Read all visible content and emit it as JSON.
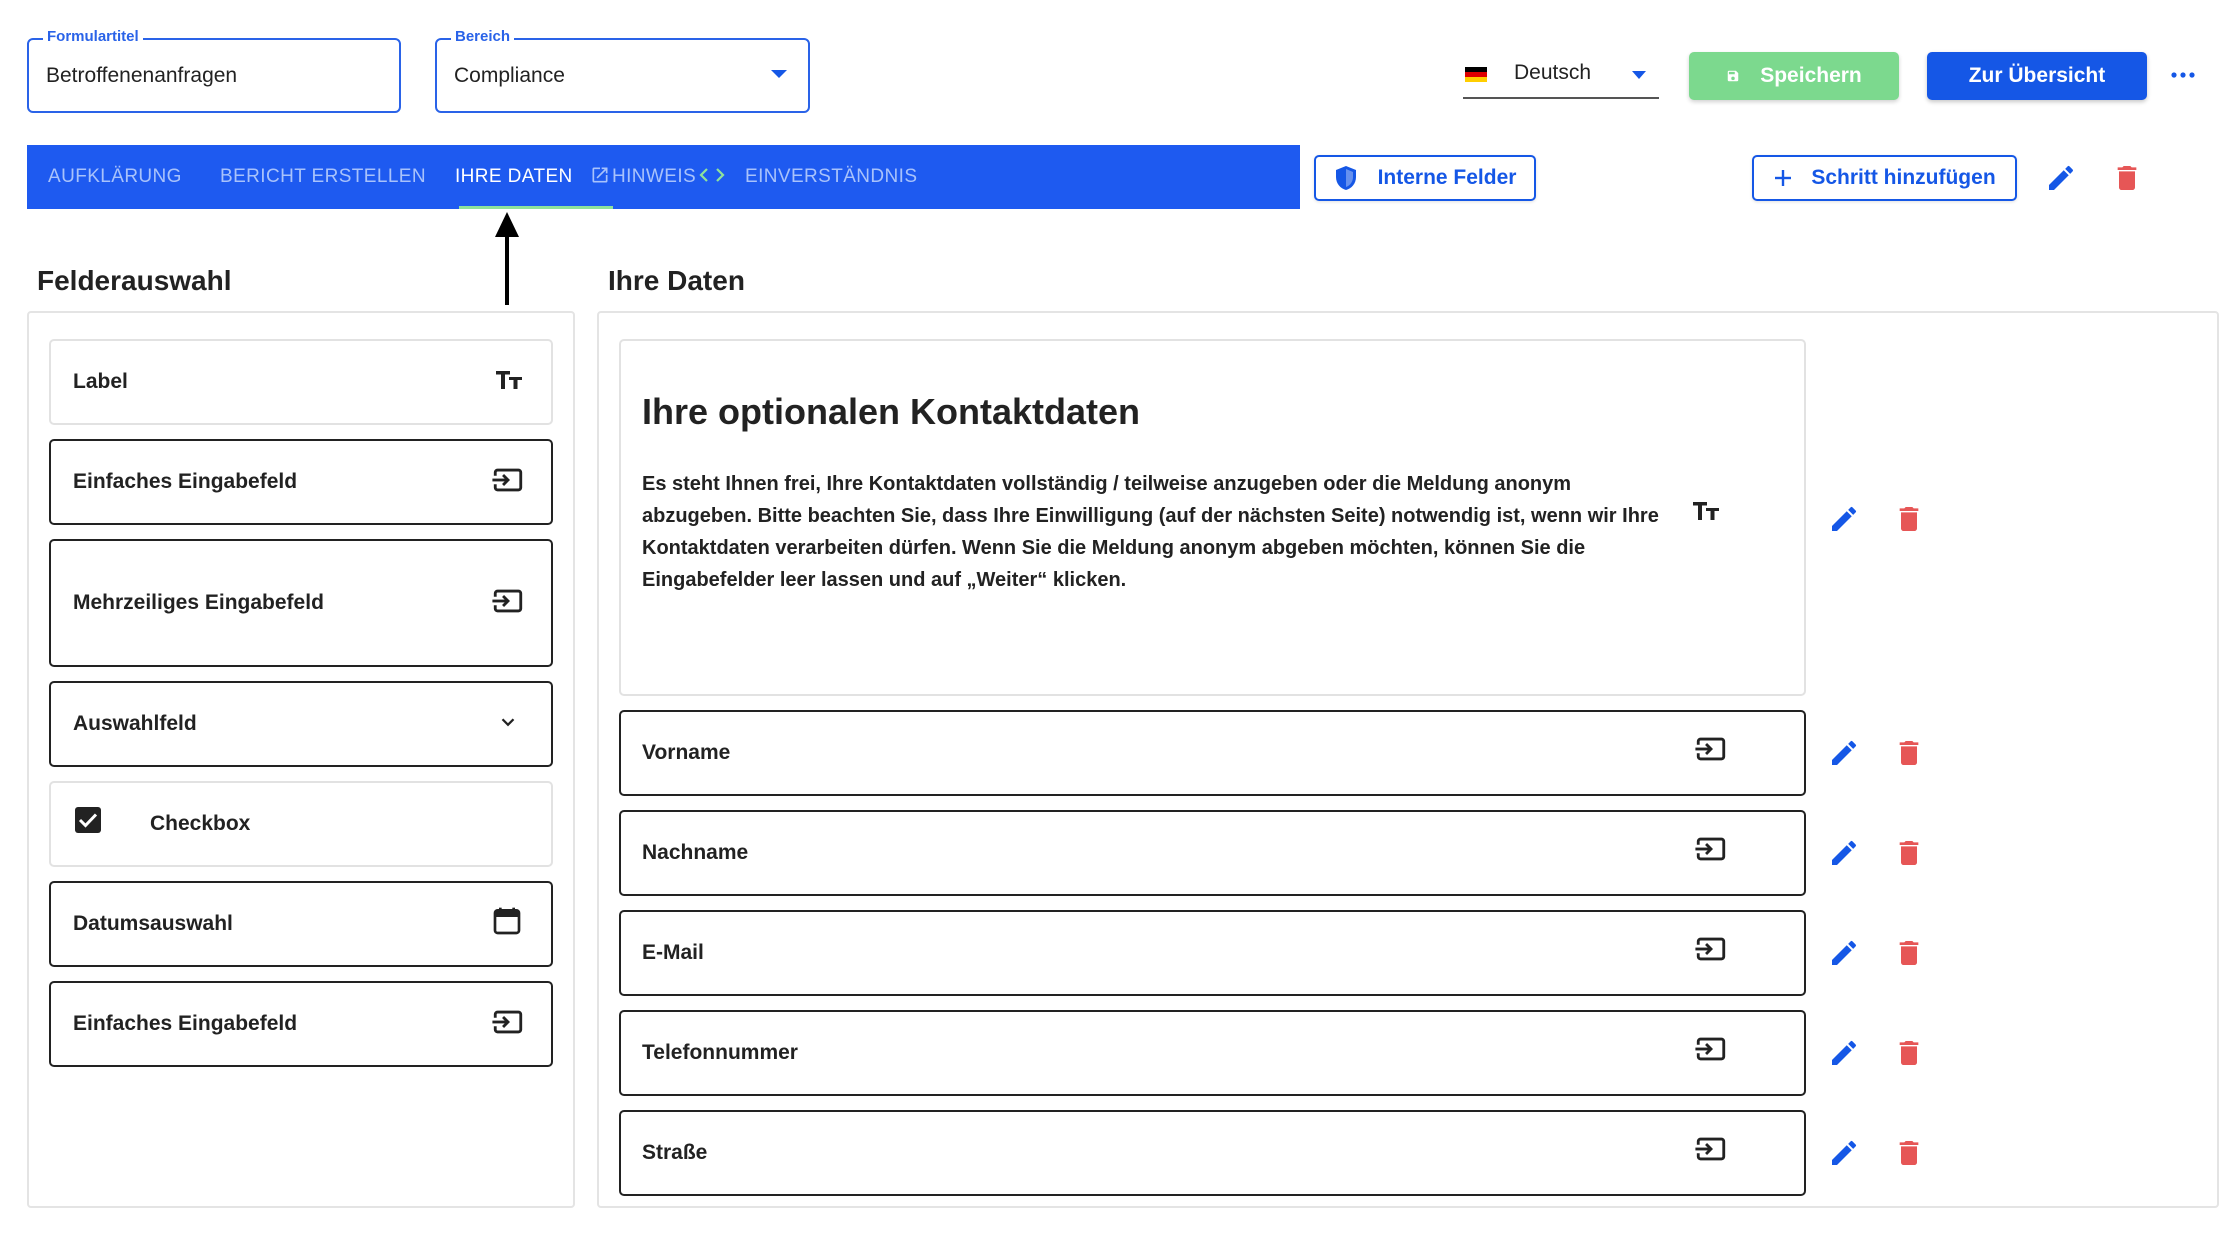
{
  "header": {
    "form_title": {
      "label": "Formulartitel",
      "value": "Betroffenenanfragen"
    },
    "area": {
      "label": "Bereich",
      "value": "Compliance"
    },
    "language": {
      "value": "Deutsch",
      "flag": "de-flag-icon"
    },
    "save_label": "Speichern",
    "overview_label": "Zur Übersicht",
    "more_icon": "more-horizontal-icon"
  },
  "tabs": [
    {
      "label": "AUFKLÄRUNG",
      "active": false
    },
    {
      "label": "BERICHT ERSTELLEN",
      "active": false
    },
    {
      "label": "IHRE DATEN",
      "active": true
    },
    {
      "label": "HINWEIS",
      "active": false
    },
    {
      "label": "EINVERSTÄNDNIS",
      "active": false
    }
  ],
  "toolbar": {
    "internal_fields_label": "Interne Felder",
    "add_step_label": "Schritt hinzufügen"
  },
  "palette": {
    "title": "Felderauswahl",
    "items": [
      {
        "label": "Label",
        "icon": "text-size-icon"
      },
      {
        "label": "Einfaches Eingabefeld",
        "icon": "input-icon"
      },
      {
        "label": "Mehrzeiliges Eingabefeld",
        "icon": "input-icon"
      },
      {
        "label": "Auswahlfeld",
        "icon": "chevron-down-icon"
      },
      {
        "label": "Checkbox",
        "icon": "checkbox-checked-icon"
      },
      {
        "label": "Datumsauswahl",
        "icon": "calendar-icon"
      },
      {
        "label": "Einfaches Eingabefeld",
        "icon": "input-icon"
      }
    ]
  },
  "step": {
    "title": "Ihre Daten",
    "text_block": {
      "heading": "Ihre optionalen Kontaktdaten",
      "body": "Es steht Ihnen frei, Ihre Kontaktdaten vollständig / teilweise anzugeben oder die Meldung anonym abzugeben. Bitte beachten Sie, dass Ihre Einwilligung (auf der nächsten Seite) notwendig ist, wenn wir Ihre Kontaktdaten verarbeiten dürfen. Wenn Sie die Meldung anonym abgeben möchten, können Sie die Eingabefelder leer lassen und auf „Weiter“ klicken.",
      "icon": "text-size-icon"
    },
    "fields": [
      {
        "label": "Vorname",
        "icon": "input-icon"
      },
      {
        "label": "Nachname",
        "icon": "input-icon"
      },
      {
        "label": "E-Mail",
        "icon": "input-icon"
      },
      {
        "label": "Telefonnummer",
        "icon": "input-icon"
      },
      {
        "label": "Straße",
        "icon": "input-icon"
      }
    ]
  },
  "colors": {
    "primary": "#1557e6",
    "tabbar": "#1e5af0",
    "save": "#7cd98e",
    "delete": "#e65656",
    "active_tab_underline": "#8fe29b"
  }
}
